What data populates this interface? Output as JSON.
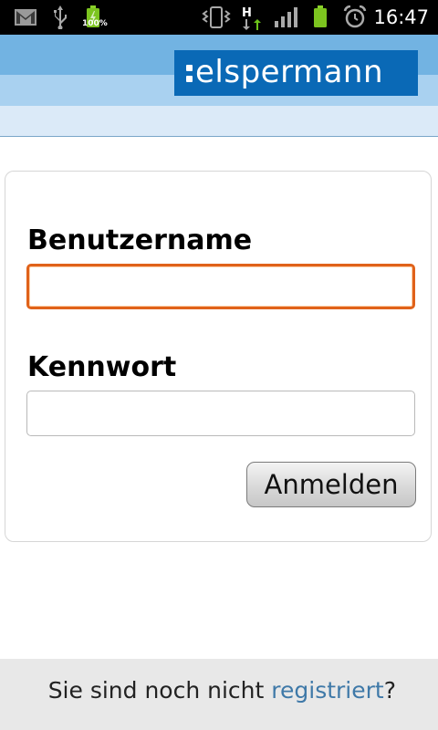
{
  "status_bar": {
    "icons": [
      "gmail-icon",
      "usb-icon",
      "battery-charging-icon",
      "vibrate-icon",
      "hspa-data-icon",
      "signal-icon",
      "battery-icon",
      "alarm-icon"
    ],
    "battery_percent": "100%",
    "network_label": "H",
    "time": "16:47"
  },
  "header": {
    "logo_text": "elspermann",
    "colors": {
      "band_top": "#72b3e2",
      "band_mid": "#a9d1f0",
      "band_low": "#dbeaf8",
      "logo_bg": "#0a69b6"
    }
  },
  "login": {
    "username_label": "Benutzername",
    "username_value": "",
    "password_label": "Kennwort",
    "password_value": "",
    "submit_label": "Anmelden",
    "focus_color": "#e0621a"
  },
  "footer": {
    "prefix": "Sie sind noch nicht ",
    "link_text": "registriert",
    "suffix": "?"
  }
}
